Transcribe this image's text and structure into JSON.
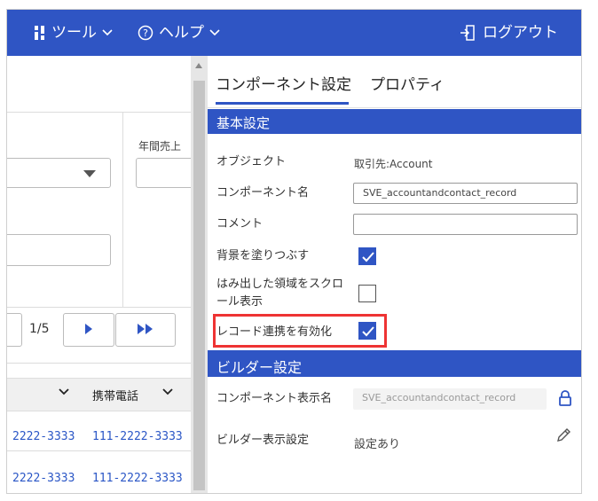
{
  "topbar": {
    "tools_label": "ツール",
    "help_label": "ヘルプ",
    "logout_label": "ログアウト",
    "tools_icon": "tools-icon",
    "help_icon": "help-circle-icon",
    "logout_icon": "logout-icon",
    "chevron_icon": "chevron-down-icon"
  },
  "left": {
    "annual_sales_label": "年間売上",
    "pager_text": "1/5",
    "next_icon": "next-page-icon",
    "last_icon": "last-page-icon",
    "table": {
      "headers": [
        "",
        "携帯電話"
      ],
      "rows": [
        [
          "2222-3333",
          "111-2222-3333"
        ],
        [
          "2222-3333",
          "111-2222-3333"
        ]
      ]
    }
  },
  "right": {
    "tabs": [
      "コンポーネント設定",
      "プロパティ"
    ],
    "basic_section": "基本設定",
    "basic": {
      "object_label": "オブジェクト",
      "object_value": "取引先:Account",
      "component_name_label": "コンポーネント名",
      "component_name_value": "SVE_accountandcontact_record",
      "comment_label": "コメント",
      "comment_value": "",
      "fill_bg_label": "背景を塗りつぶす",
      "fill_bg_checked": true,
      "scroll_label_1": "はみ出した領域をスクロ",
      "scroll_label_2": "ール表示",
      "scroll_checked": false,
      "record_link_label": "レコード連携を有効化",
      "record_link_checked": true
    },
    "builder_section": "ビルダー設定",
    "builder": {
      "display_name_label": "コンポーネント表示名",
      "display_name_value": "SVE_accountandcontact_record",
      "lock_icon": "lock-icon",
      "display_setting_label": "ビルダー表示設定",
      "display_setting_value": "設定あり",
      "edit_icon": "pencil-icon"
    }
  },
  "colors": {
    "brand_blue": "#2f55c4",
    "link_blue": "#2a56c6",
    "highlight_red": "#e33333"
  }
}
